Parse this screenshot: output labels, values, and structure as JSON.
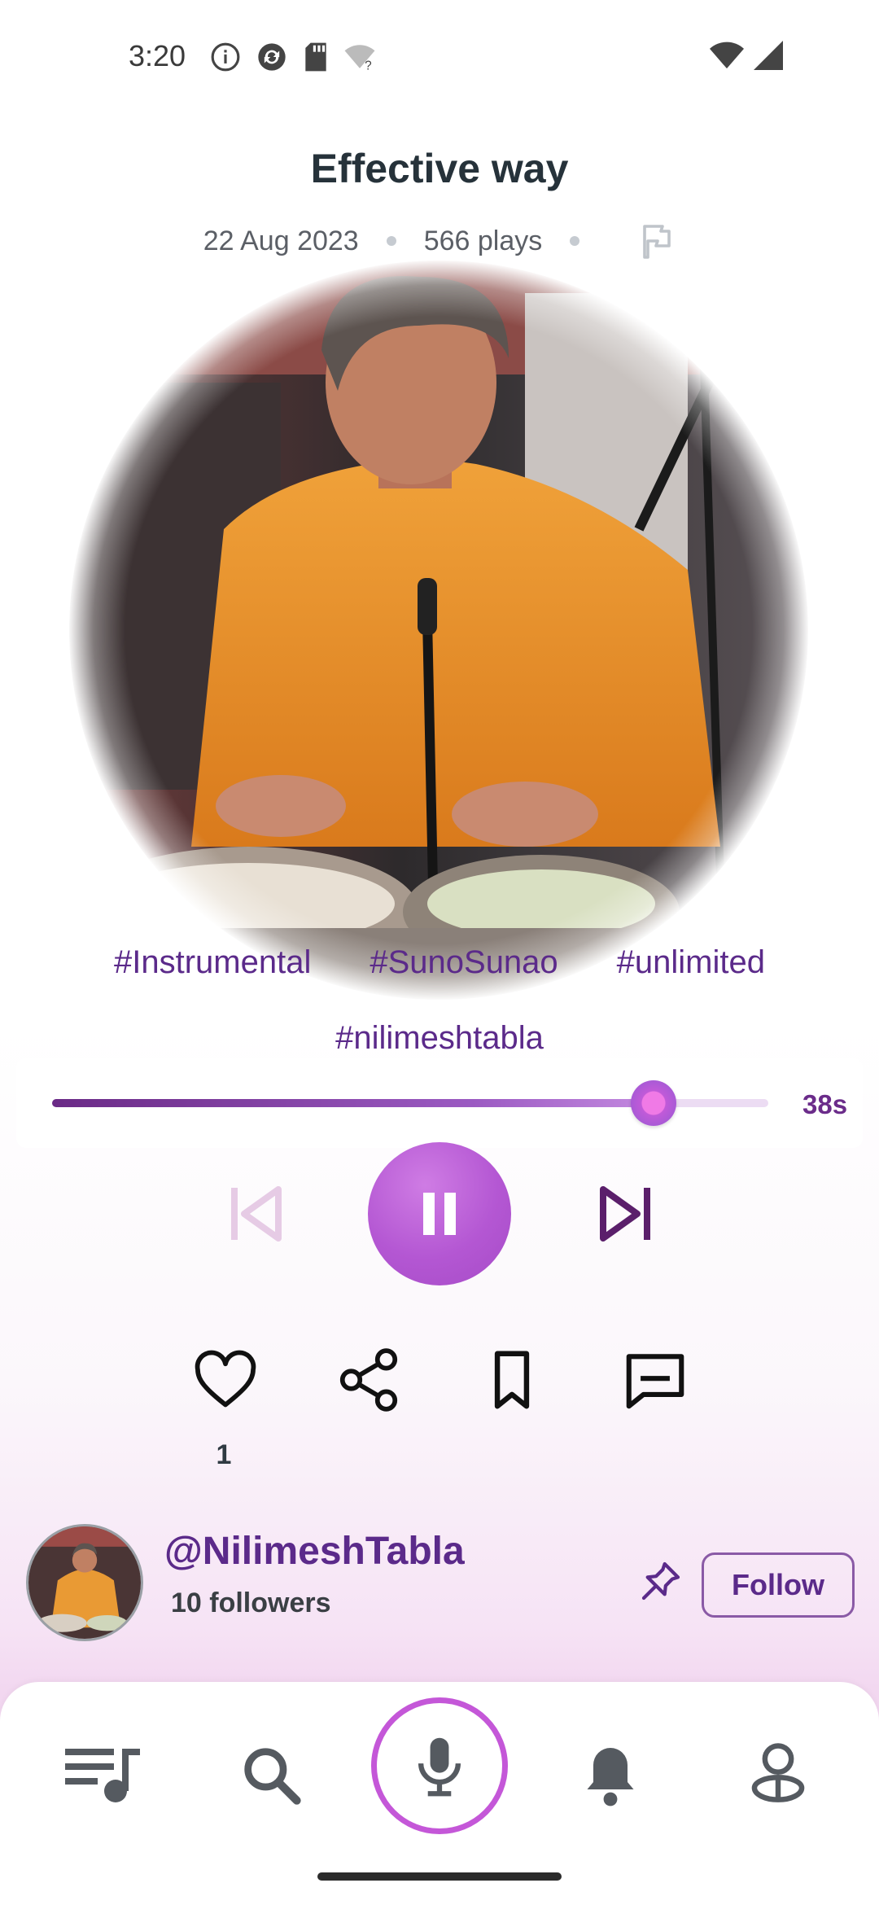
{
  "status_bar": {
    "time": "3:20",
    "icons_left": [
      "info-icon",
      "sync-icon",
      "sd-card-icon",
      "wifi-question-icon"
    ],
    "icons_right": [
      "wifi-icon",
      "signal-icon"
    ]
  },
  "track": {
    "title": "Effective way",
    "date": "22 Aug 2023",
    "plays": "566 plays",
    "tags": [
      "#Instrumental",
      "#SunoSunao",
      "#unlimited",
      "#nilimeshtabla"
    ]
  },
  "player": {
    "progress": 0.84,
    "time_label": "38s",
    "state": "playing"
  },
  "actions": {
    "like_count": "1"
  },
  "artist": {
    "handle": "@NilimeshTabla",
    "followers": "10 followers",
    "follow_label": "Follow"
  },
  "nav": {
    "items": [
      "playlist-icon",
      "search-icon",
      "mic-icon",
      "bell-icon",
      "profile-icon"
    ]
  },
  "colors": {
    "accent": "#5b2a8a",
    "play_button": "#b457d3",
    "mic_ring": "#c457d8"
  }
}
